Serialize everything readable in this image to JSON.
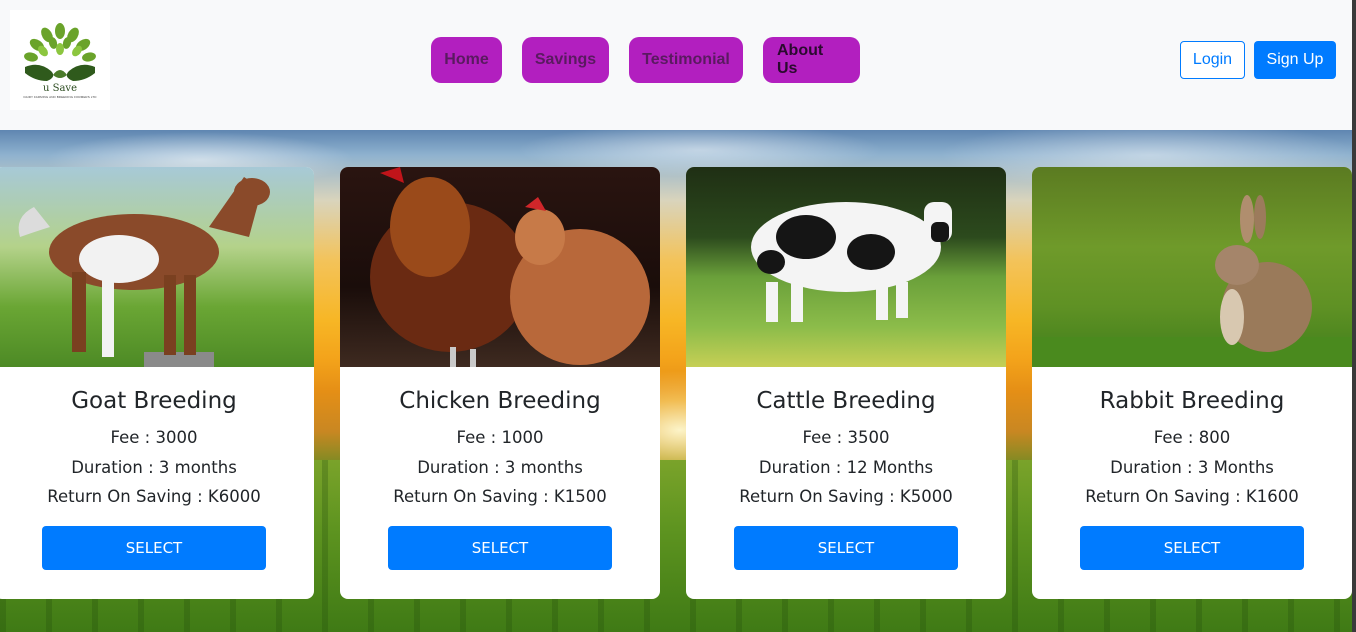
{
  "logo": {
    "name": "u Save",
    "tagline": "DAIRY FARMING AND BREEDING FORMERS LTD"
  },
  "nav": {
    "links": [
      {
        "label": "Home"
      },
      {
        "label": "Savings"
      },
      {
        "label": "Testimonial"
      },
      {
        "label": "About Us"
      }
    ]
  },
  "auth": {
    "login_label": "Login",
    "signup_label": "Sign Up"
  },
  "colors": {
    "nav_button": "#b21fbf",
    "primary": "#007bff"
  },
  "cards": [
    {
      "title": "Goat Breeding",
      "fee": "Fee : 3000",
      "duration": "Duration : 3 months",
      "return": "Return On Saving : K6000",
      "button": "SELECT",
      "image": "goat-image"
    },
    {
      "title": "Chicken Breeding",
      "fee": "Fee : 1000",
      "duration": "Duration : 3 months",
      "return": "Return On Saving : K1500",
      "button": "SELECT",
      "image": "chicken-image"
    },
    {
      "title": "Cattle Breeding",
      "fee": "Fee : 3500",
      "duration": "Duration : 12 Months",
      "return": "Return On Saving : K5000",
      "button": "SELECT",
      "image": "cattle-image"
    },
    {
      "title": "Rabbit Breeding",
      "fee": "Fee : 800",
      "duration": "Duration : 3 Months",
      "return": "Return On Saving : K1600",
      "button": "SELECT",
      "image": "rabbit-image"
    }
  ]
}
